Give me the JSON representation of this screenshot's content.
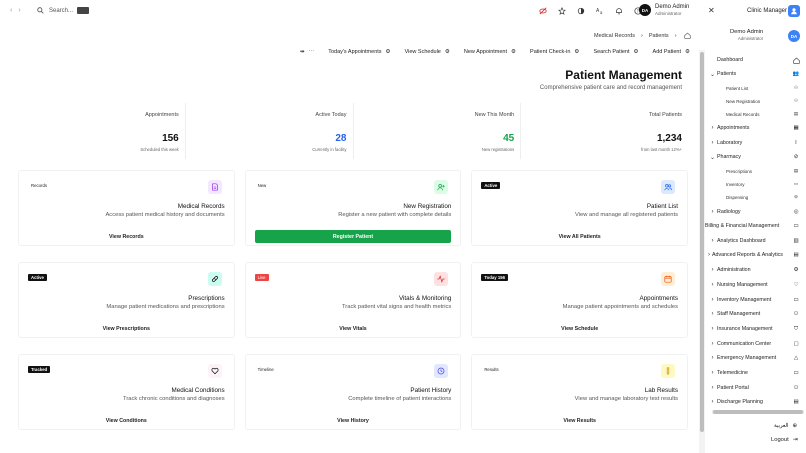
{
  "topbar": {
    "search_placeholder": "Search...",
    "user_initials": "DA",
    "user_name": "Demo Admin",
    "user_role": "Administrator",
    "app_title": "Clinic Manager"
  },
  "breadcrumb": {
    "items": [
      "Medical Records",
      "Patients"
    ],
    "user_name": "Demo Admin",
    "user_role": "Administrator",
    "user_initials": "DA"
  },
  "toolbar": {
    "appointments": "Today's Appointments",
    "schedule": "View Schedule",
    "new_appointment": "New Appointment",
    "checkin": "Patient Check-in",
    "search_patient": "Search Patient",
    "add_patient": "Add Patient"
  },
  "header": {
    "title": "Patient Management",
    "subtitle": "Comprehensive patient care and record management"
  },
  "stats": [
    {
      "label": "Appointments",
      "value": "156",
      "note": "Scheduled this week"
    },
    {
      "label": "Active Today",
      "value": "28",
      "note": "Currently in facility"
    },
    {
      "label": "New This Month",
      "value": "45",
      "note": "New registrations"
    },
    {
      "label": "Total Patients",
      "value": "1,234",
      "note": "from last month 12%+"
    }
  ],
  "cards": [
    {
      "badge": "Records",
      "title": "Medical Records",
      "desc": "Access patient medical history and documents",
      "button": "View Records"
    },
    {
      "badge": "New",
      "title": "New Registration",
      "desc": "Register a new patient with complete details",
      "button": "Register Patient"
    },
    {
      "badge": "Active",
      "title": "Patient List",
      "desc": "View and manage all registered patients",
      "button": "View All Patients"
    },
    {
      "badge": "Active",
      "title": "Prescriptions",
      "desc": "Manage patient medications and prescriptions",
      "button": "View Prescriptions"
    },
    {
      "badge": "Live",
      "title": "Vitals & Monitoring",
      "desc": "Track patient vital signs and health metrics",
      "button": "View Vitals"
    },
    {
      "badge": "Today 156",
      "title": "Appointments",
      "desc": "Manage patient appointments and schedules",
      "button": "View Schedule"
    },
    {
      "badge": "Tracked",
      "title": "Medical Conditions",
      "desc": "Track chronic conditions and diagnoses",
      "button": "View Conditions"
    },
    {
      "badge": "Timeline",
      "title": "Patient History",
      "desc": "Complete timeline of patient interactions",
      "button": "View History"
    },
    {
      "badge": "Results",
      "title": "Lab Results",
      "desc": "View and manage laboratory test results",
      "button": "View Results"
    }
  ],
  "colors": {
    "accent": "#3b82f6",
    "success": "#16a34a",
    "danger": "#ef4444",
    "dark": "#111111"
  },
  "sidebar": {
    "items": [
      {
        "label": "Dashboard"
      },
      {
        "label": "Patients"
      },
      {
        "label": "Patient List"
      },
      {
        "label": "New Registration"
      },
      {
        "label": "Medical Records"
      },
      {
        "label": "Appointments"
      },
      {
        "label": "Laboratory"
      },
      {
        "label": "Pharmacy"
      },
      {
        "label": "Prescriptions"
      },
      {
        "label": "Inventory"
      },
      {
        "label": "Dispensing"
      },
      {
        "label": "Radiology"
      },
      {
        "label": "Billing & Financial Management"
      },
      {
        "label": "Analytics Dashboard"
      },
      {
        "label": "Advanced Reports & Analytics"
      },
      {
        "label": "Administration"
      },
      {
        "label": "Nursing Management"
      },
      {
        "label": "Inventory Management"
      },
      {
        "label": "Staff Management"
      },
      {
        "label": "Insurance Management"
      },
      {
        "label": "Communication Center"
      },
      {
        "label": "Emergency Management"
      },
      {
        "label": "Telemedicine"
      },
      {
        "label": "Patient Portal"
      },
      {
        "label": "Discharge Planning"
      }
    ],
    "language": "العربية",
    "logout": "Logout"
  }
}
